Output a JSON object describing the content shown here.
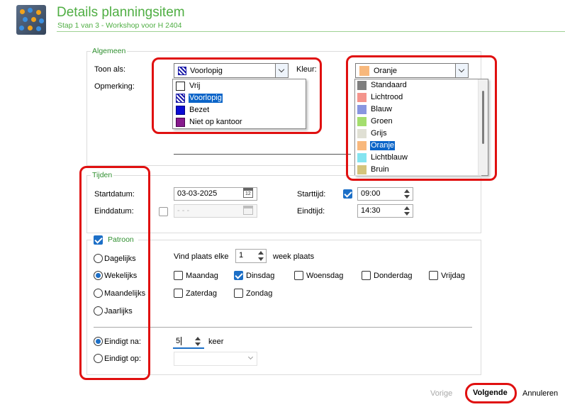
{
  "header": {
    "title": "Details planningsitem",
    "subtitle": "Stap 1 van 3 - Workshop voor H 2404"
  },
  "algemeen": {
    "legend": "Algemeen",
    "toon_als_label": "Toon als:",
    "toon_als_value": "Voorlopig",
    "opmerking_label": "Opmerking:",
    "kleur_label": "Kleur:",
    "kleur_value": "Oranje",
    "toon_als_options": [
      "Vrij",
      "Voorlopig",
      "Bezet",
      "Niet op kantoor"
    ],
    "kleur_options": [
      {
        "label": "Standaard",
        "color": "#7f7f7f"
      },
      {
        "label": "Lichtrood",
        "color": "#f4948c"
      },
      {
        "label": "Blauw",
        "color": "#8896e0"
      },
      {
        "label": "Groen",
        "color": "#a4de6e"
      },
      {
        "label": "Grijs",
        "color": "#e0e0d4"
      },
      {
        "label": "Oranje",
        "color": "#f8b87c"
      },
      {
        "label": "Lichtblauw",
        "color": "#84e4f0"
      },
      {
        "label": "Bruin",
        "color": "#d4c47c"
      }
    ]
  },
  "tijden": {
    "legend": "Tijden",
    "startdatum_label": "Startdatum:",
    "startdatum_value": "03-03-2025",
    "einddatum_label": "Einddatum:",
    "einddatum_value": "- - -",
    "starttijd_label": "Starttijd:",
    "starttijd_value": "09:00",
    "eindtijd_label": "Eindtijd:",
    "eindtijd_value": "14:30"
  },
  "patroon": {
    "legend": "Patroon",
    "freq": [
      "Dagelijks",
      "Wekelijks",
      "Maandelijks",
      "Jaarlijks"
    ],
    "vind_label": "Vind plaats elke",
    "vind_value": "1",
    "week_label": "week plaats",
    "days": [
      "Maandag",
      "Dinsdag",
      "Woensdag",
      "Donderdag",
      "Vrijdag",
      "Zaterdag",
      "Zondag"
    ],
    "eindigt_na_label": "Eindigt na:",
    "eindigt_na_value": "5",
    "keer_label": "keer",
    "eindigt_op_label": "Eindigt op:"
  },
  "footer": {
    "vorige": "Vorige",
    "volgende": "Volgende",
    "annuleren": "Annuleren"
  },
  "colors": {
    "accent_green": "#4fae43",
    "highlight_red": "#e01010",
    "selection_blue": "#0a64c8"
  }
}
